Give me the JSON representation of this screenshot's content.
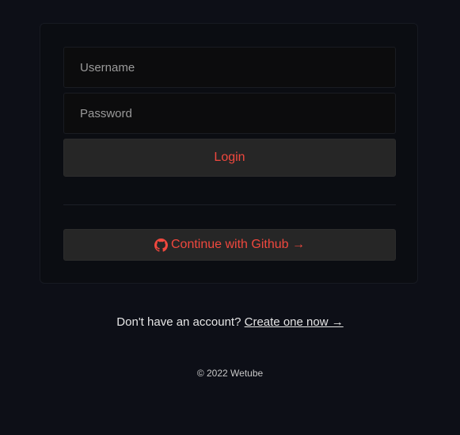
{
  "login_form": {
    "username_placeholder": "Username",
    "password_placeholder": "Password",
    "login_label": "Login"
  },
  "social": {
    "github_label": "Continue with Github →",
    "icon": "github-icon"
  },
  "signup": {
    "prompt": "Don't have an account?",
    "link_label": "Create one now →"
  },
  "footer": {
    "copyright": "© 2022 Wetube"
  },
  "colors": {
    "background": "#0d0f17",
    "accent": "#f0483e",
    "button_bg": "#262626"
  }
}
